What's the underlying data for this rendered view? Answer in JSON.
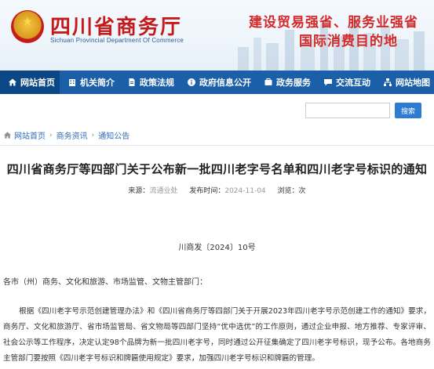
{
  "header": {
    "title": "四川省商务厅",
    "subtitle": "Sichuan Provincial Department Of Commerce",
    "slogan_line1": "建设贸易强省、服务业强省",
    "slogan_line2": "国际消费目的地"
  },
  "nav": {
    "items": [
      {
        "label": "网站首页",
        "icon": "home-icon"
      },
      {
        "label": "机关简介",
        "icon": "building-icon"
      },
      {
        "label": "政策法规",
        "icon": "document-icon"
      },
      {
        "label": "政府信息公开",
        "icon": "info-icon"
      },
      {
        "label": "政务服务",
        "icon": "service-icon"
      },
      {
        "label": "交流互动",
        "icon": "chat-icon"
      },
      {
        "label": "网站地图",
        "icon": "sitemap-icon"
      }
    ]
  },
  "search": {
    "placeholder": "",
    "button_label": "搜索"
  },
  "breadcrumb": {
    "items": [
      "网站首页",
      "商务资讯",
      "通知公告"
    ]
  },
  "article": {
    "title": "四川省商务厅等四部门关于公布新一批四川老字号名单和四川老字号标识的通知",
    "source_label": "来源：",
    "source": "流通业处",
    "date_label": "发布时间：",
    "date": "2024-11-04",
    "views_label": "浏览：",
    "views": "次",
    "doc_number": "川商发〔2024〕10号",
    "salutation": "各市（州）商务、文化和旅游、市场监管、文物主管部门：",
    "paragraph": "根据《四川老字号示范创建管理办法》和《四川省商务厅等四部门关于开展2023年四川老字号示范创建工作的通知》要求，商务厅、文化和旅游厅、省市场监管局、省文物局等四部门坚持“优中选优”的工作原则，通过企业申报、地方推荐、专家评审、社会公示等工作程序，决定认定98个品牌为新一批四川老字号，同时通过公开征集确定了四川老字号标识，现予公布。各地商务主管部门要按照《四川老字号标识和牌匾使用规定》要求，加强四川老字号标识和牌匾的管理。"
  },
  "colors": {
    "nav_bg": "#1a5fa8",
    "title_red": "#c41a1a",
    "link_blue": "#2e6db8"
  }
}
